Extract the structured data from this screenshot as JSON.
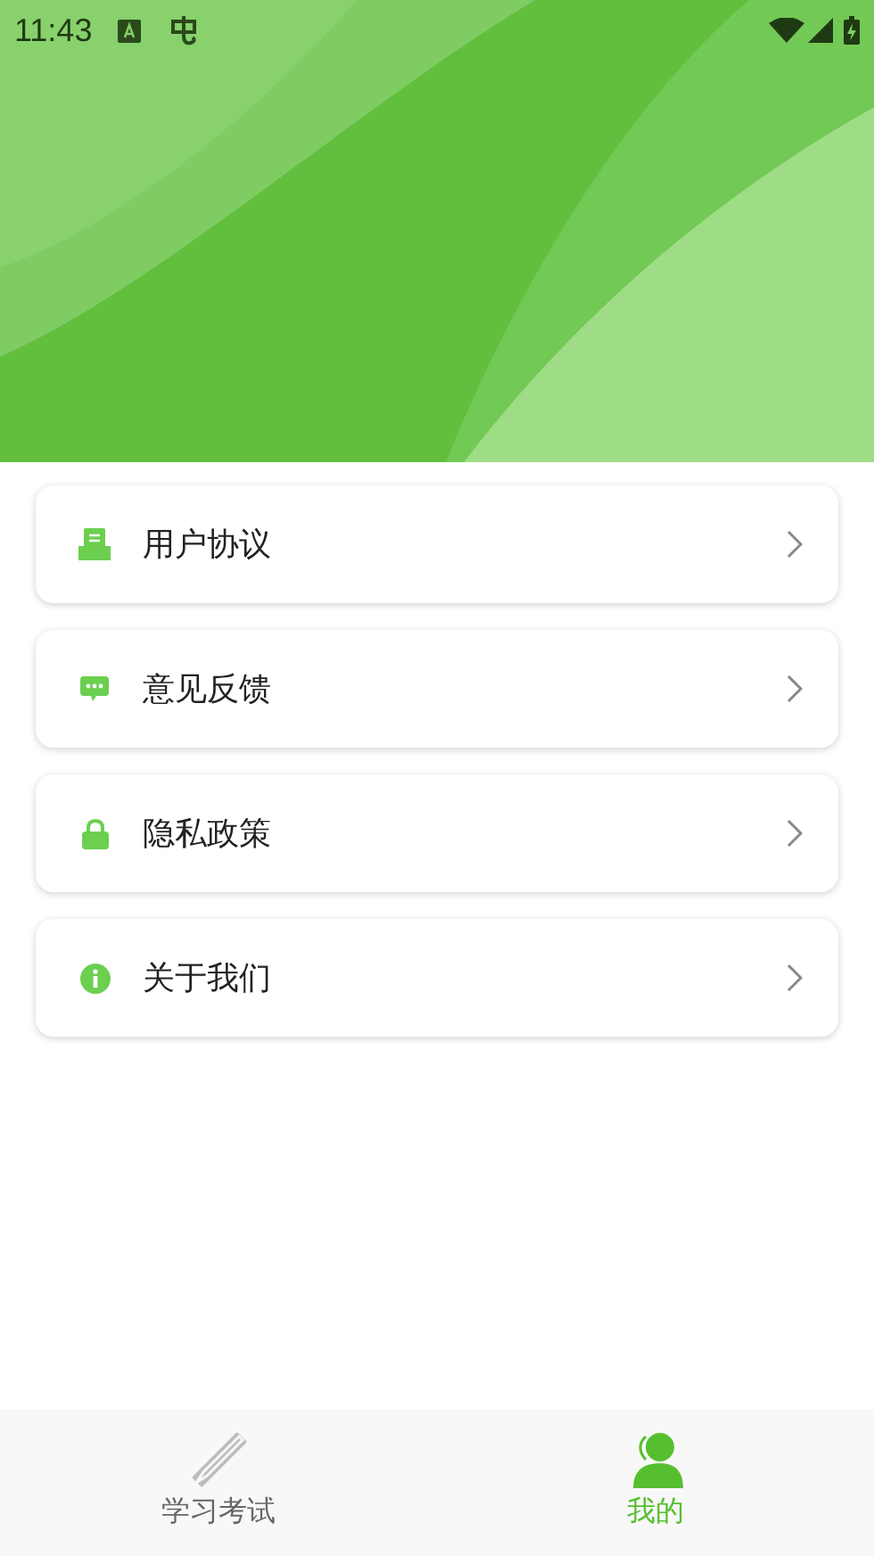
{
  "status_bar": {
    "time": "11:43"
  },
  "menu": [
    {
      "kind": "agreement",
      "label": "用户协议"
    },
    {
      "kind": "feedback",
      "label": "意见反馈"
    },
    {
      "kind": "privacy",
      "label": "隐私政策"
    },
    {
      "kind": "about",
      "label": "关于我们"
    }
  ],
  "tabs": [
    {
      "kind": "study",
      "label": "学习考试",
      "selected": false
    },
    {
      "kind": "mine",
      "label": "我的",
      "selected": true
    }
  ]
}
